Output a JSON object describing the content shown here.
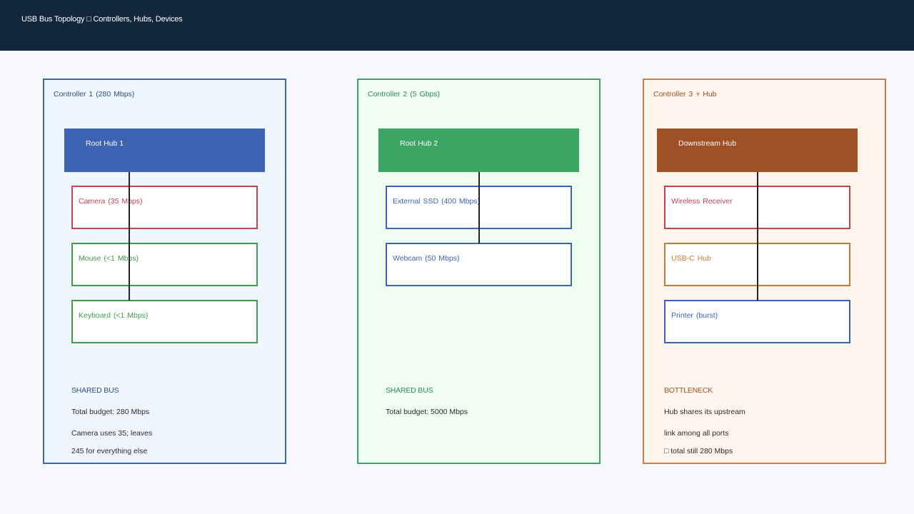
{
  "header": {
    "title": "USB Bus Topology □ Controllers, Hubs, Devices"
  },
  "colors": {
    "topbar": "#13273c",
    "blue": "#3d63b5",
    "green": "#3da564",
    "orange": "#a05027",
    "red": "#c0444f",
    "device_green": "#3f9b4e",
    "device_orange": "#c47a3a"
  },
  "controllers": [
    {
      "title": "Controller 1  (280 Mbps)",
      "hub": "Root Hub 1",
      "devices": [
        {
          "label": "Camera  (35 Mbps)"
        },
        {
          "label": "Mouse  (<1 Mbps)"
        },
        {
          "label": "Keyboard  (<1 Mbps)"
        }
      ],
      "note": {
        "heading": "SHARED BUS",
        "lines": [
          "Total budget: 280 Mbps",
          "Camera uses 35; leaves",
          "245 for everything else"
        ]
      }
    },
    {
      "title": "Controller 2  (5 Gbps)",
      "hub": "Root Hub 2",
      "devices": [
        {
          "label": "External SSD  (400 Mbps)"
        },
        {
          "label": "Webcam  (50 Mbps)"
        }
      ],
      "note": {
        "heading": "SHARED BUS",
        "lines": [
          "Total budget: 5000 Mbps"
        ]
      }
    },
    {
      "title": "Controller 3  + Hub",
      "hub": "Downstream Hub",
      "devices": [
        {
          "label": "Wireless Receiver"
        },
        {
          "label": "USB-C Hub"
        },
        {
          "label": "Printer  (burst)"
        }
      ],
      "note": {
        "heading": "BOTTLENECK",
        "lines": [
          "Hub shares its upstream",
          "link among all ports",
          "□ total still 280 Mbps"
        ]
      }
    }
  ]
}
